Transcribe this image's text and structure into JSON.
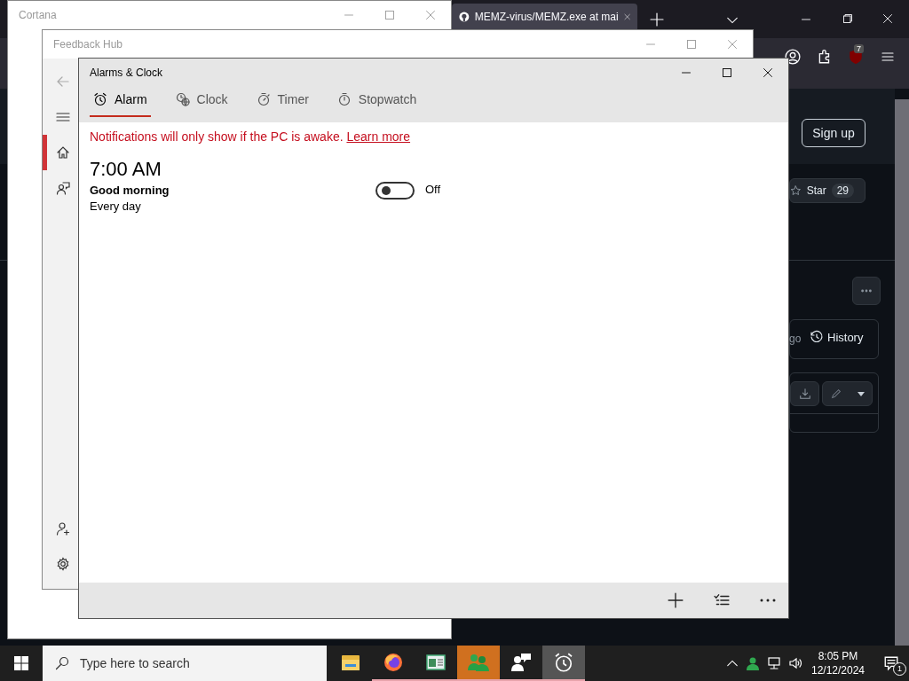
{
  "browser": {
    "tab_title": "MEMZ-virus/MEMZ.exe at mai",
    "extension_badge": "7",
    "sign_up": "Sign up",
    "star_label": "Star",
    "star_count": "29",
    "cut_text": "go",
    "history": "History"
  },
  "cortana": {
    "title": "Cortana"
  },
  "feedback_hub": {
    "title": "Feedback Hub",
    "nav": [
      {
        "kind": "home",
        "selected": true
      },
      {
        "kind": "feedback",
        "selected": false
      }
    ],
    "nav_bottom": [
      {
        "kind": "add-account",
        "selected": false
      },
      {
        "kind": "settings",
        "selected": false
      }
    ]
  },
  "alarms_clock": {
    "title": "Alarms & Clock",
    "tabs": [
      {
        "label": "Alarm",
        "kind": "alarm",
        "selected": true
      },
      {
        "label": "Clock",
        "kind": "clock",
        "selected": false
      },
      {
        "label": "Timer",
        "kind": "timer",
        "selected": false
      },
      {
        "label": "Stopwatch",
        "kind": "stopwatch",
        "selected": false
      }
    ],
    "notice": "Notifications will only show if the PC is awake.",
    "notice_link": "Learn more",
    "alarms": [
      {
        "time": "7:00 AM",
        "name": "Good morning",
        "repeat": "Every day",
        "on": false,
        "state_label": "Off"
      }
    ]
  },
  "taskbar": {
    "search_placeholder": "Type here to search",
    "apps": [
      {
        "kind": "folder",
        "selected": false,
        "flashing": false,
        "running": false
      },
      {
        "kind": "firefox",
        "selected": false,
        "flashing": false,
        "running": true
      },
      {
        "kind": "window",
        "selected": false,
        "flashing": false,
        "running": true
      },
      {
        "kind": "people",
        "selected": false,
        "flashing": true,
        "running": true
      },
      {
        "kind": "chat",
        "selected": false,
        "flashing": false,
        "running": true
      },
      {
        "kind": "alarm",
        "selected": true,
        "flashing": false,
        "running": true
      }
    ],
    "time": "8:05 PM",
    "date": "12/12/2024",
    "notification_count": "1"
  }
}
